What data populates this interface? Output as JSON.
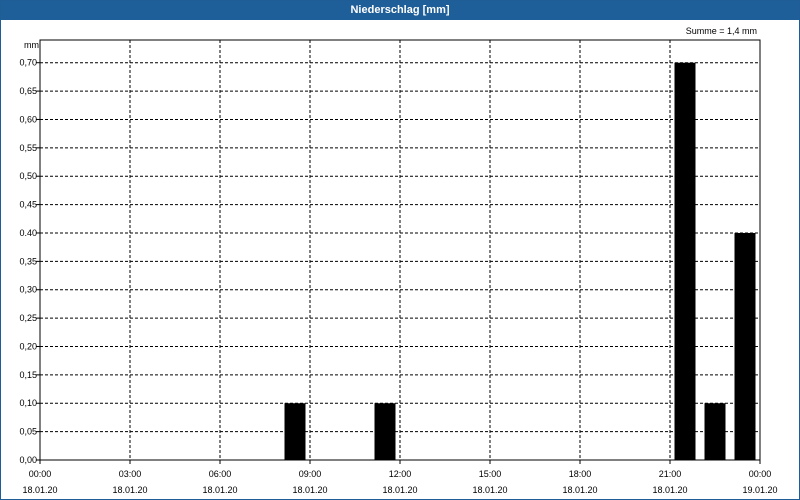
{
  "chart_data": {
    "type": "bar",
    "title": "Niederschlag [mm]",
    "ylabel": "mm",
    "summary": "Summe = 1,4 mm",
    "ylim": [
      0,
      0.74
    ],
    "xlim_hours": [
      0,
      24
    ],
    "y_ticks": [
      {
        "value": 0.0,
        "label": "0,00"
      },
      {
        "value": 0.05,
        "label": "0,05"
      },
      {
        "value": 0.1,
        "label": "0,10"
      },
      {
        "value": 0.15,
        "label": "0,15"
      },
      {
        "value": 0.2,
        "label": "0,20"
      },
      {
        "value": 0.25,
        "label": "0,25"
      },
      {
        "value": 0.3,
        "label": "0,30"
      },
      {
        "value": 0.35,
        "label": "0,35"
      },
      {
        "value": 0.4,
        "label": "0.40"
      },
      {
        "value": 0.45,
        "label": "0,45"
      },
      {
        "value": 0.5,
        "label": "0,50"
      },
      {
        "value": 0.55,
        "label": "0,55"
      },
      {
        "value": 0.6,
        "label": "0,60"
      },
      {
        "value": 0.65,
        "label": "0,65"
      },
      {
        "value": 0.7,
        "label": "0,70"
      }
    ],
    "x_ticks": [
      {
        "hour": 0,
        "time": "00:00",
        "date": "18.01.20"
      },
      {
        "hour": 3,
        "time": "03:00",
        "date": "18.01.20"
      },
      {
        "hour": 6,
        "time": "06:00",
        "date": "18.01.20"
      },
      {
        "hour": 9,
        "time": "09:00",
        "date": "18.01.20"
      },
      {
        "hour": 12,
        "time": "12:00",
        "date": "18.01.20"
      },
      {
        "hour": 15,
        "time": "15:00",
        "date": "18.01.20"
      },
      {
        "hour": 18,
        "time": "18:00",
        "date": "18.01.20"
      },
      {
        "hour": 21,
        "time": "21:00",
        "date": "18.01.20"
      },
      {
        "hour": 24,
        "time": "00:00",
        "date": "19.01.20"
      }
    ],
    "bars": [
      {
        "hour": 8.5,
        "value": 0.1
      },
      {
        "hour": 11.5,
        "value": 0.1
      },
      {
        "hour": 21.5,
        "value": 0.7
      },
      {
        "hour": 22.5,
        "value": 0.1
      },
      {
        "hour": 23.5,
        "value": 0.4
      }
    ],
    "grid": true,
    "bar_color": "#000000",
    "title_bar_color": "#1f5f99"
  }
}
